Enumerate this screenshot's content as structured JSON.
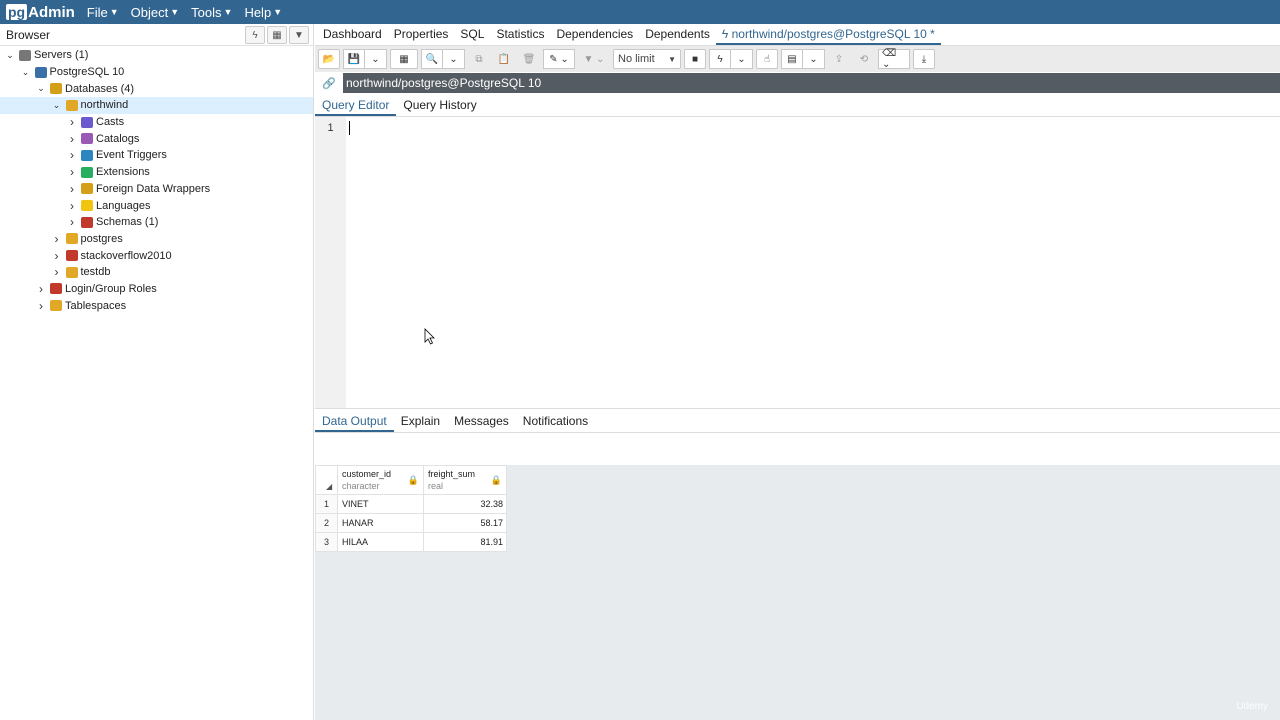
{
  "app": {
    "logo_pg": "pg",
    "logo_admin": "Admin"
  },
  "menubar": {
    "items": [
      "File",
      "Object",
      "Tools",
      "Help"
    ]
  },
  "browser": {
    "title": "Browser",
    "tree": [
      {
        "label": "Servers (1)",
        "level": 0,
        "toggle": "open",
        "icon": "servers-icon",
        "color": "#777777"
      },
      {
        "label": "PostgreSQL 10",
        "level": 1,
        "toggle": "open",
        "icon": "server-icon",
        "color": "#3b6fa8"
      },
      {
        "label": "Databases (4)",
        "level": 2,
        "toggle": "open",
        "icon": "databases-icon",
        "color": "#d4a017"
      },
      {
        "label": "northwind",
        "level": 3,
        "toggle": "open",
        "icon": "database-icon",
        "color": "#e0a826",
        "selected": true
      },
      {
        "label": "Casts",
        "level": 4,
        "toggle": "closed",
        "icon": "casts-icon",
        "color": "#6a5acd"
      },
      {
        "label": "Catalogs",
        "level": 4,
        "toggle": "closed",
        "icon": "catalogs-icon",
        "color": "#9b59b6"
      },
      {
        "label": "Event Triggers",
        "level": 4,
        "toggle": "closed",
        "icon": "event-triggers-icon",
        "color": "#2e86c1"
      },
      {
        "label": "Extensions",
        "level": 4,
        "toggle": "closed",
        "icon": "extensions-icon",
        "color": "#27ae60"
      },
      {
        "label": "Foreign Data Wrappers",
        "level": 4,
        "toggle": "closed",
        "icon": "fdw-icon",
        "color": "#d4a017"
      },
      {
        "label": "Languages",
        "level": 4,
        "toggle": "closed",
        "icon": "languages-icon",
        "color": "#f1c40f"
      },
      {
        "label": "Schemas (1)",
        "level": 4,
        "toggle": "closed",
        "icon": "schemas-icon",
        "color": "#c0392b"
      },
      {
        "label": "postgres",
        "level": 3,
        "toggle": "closed",
        "icon": "database-icon",
        "color": "#e0a826"
      },
      {
        "label": "stackoverflow2010",
        "level": 3,
        "toggle": "closed",
        "icon": "database-disconnected-icon",
        "color": "#c0392b"
      },
      {
        "label": "testdb",
        "level": 3,
        "toggle": "closed",
        "icon": "database-icon",
        "color": "#e0a826"
      },
      {
        "label": "Login/Group Roles",
        "level": 2,
        "toggle": "closed",
        "icon": "roles-icon",
        "color": "#c0392b"
      },
      {
        "label": "Tablespaces",
        "level": 2,
        "toggle": "closed",
        "icon": "tablespaces-icon",
        "color": "#e0a826"
      }
    ]
  },
  "tabs": {
    "items": [
      "Dashboard",
      "Properties",
      "SQL",
      "Statistics",
      "Dependencies",
      "Dependents"
    ],
    "query_tab": "northwind/postgres@PostgreSQL 10 *"
  },
  "toolbar": {
    "limit": "No limit"
  },
  "connection": {
    "label": "northwind/postgres@PostgreSQL 10"
  },
  "editor_tabs": {
    "query_editor": "Query Editor",
    "query_history": "Query History"
  },
  "editor": {
    "line_number": "1"
  },
  "output_tabs": {
    "data_output": "Data Output",
    "explain": "Explain",
    "messages": "Messages",
    "notifications": "Notifications"
  },
  "grid": {
    "columns": [
      {
        "name": "customer_id",
        "type": "character"
      },
      {
        "name": "freight_sum",
        "type": "real"
      }
    ],
    "rows": [
      {
        "n": "1",
        "customer_id": "VINET",
        "freight_sum": "32.38"
      },
      {
        "n": "2",
        "customer_id": "HANAR",
        "freight_sum": "58.17"
      },
      {
        "n": "3",
        "customer_id": "HILAA",
        "freight_sum": "81.91"
      }
    ]
  },
  "watermark": "Udemy",
  "colors": {
    "brand": "#326690",
    "selection": "#dcefff",
    "conn_bar": "#555b62"
  }
}
